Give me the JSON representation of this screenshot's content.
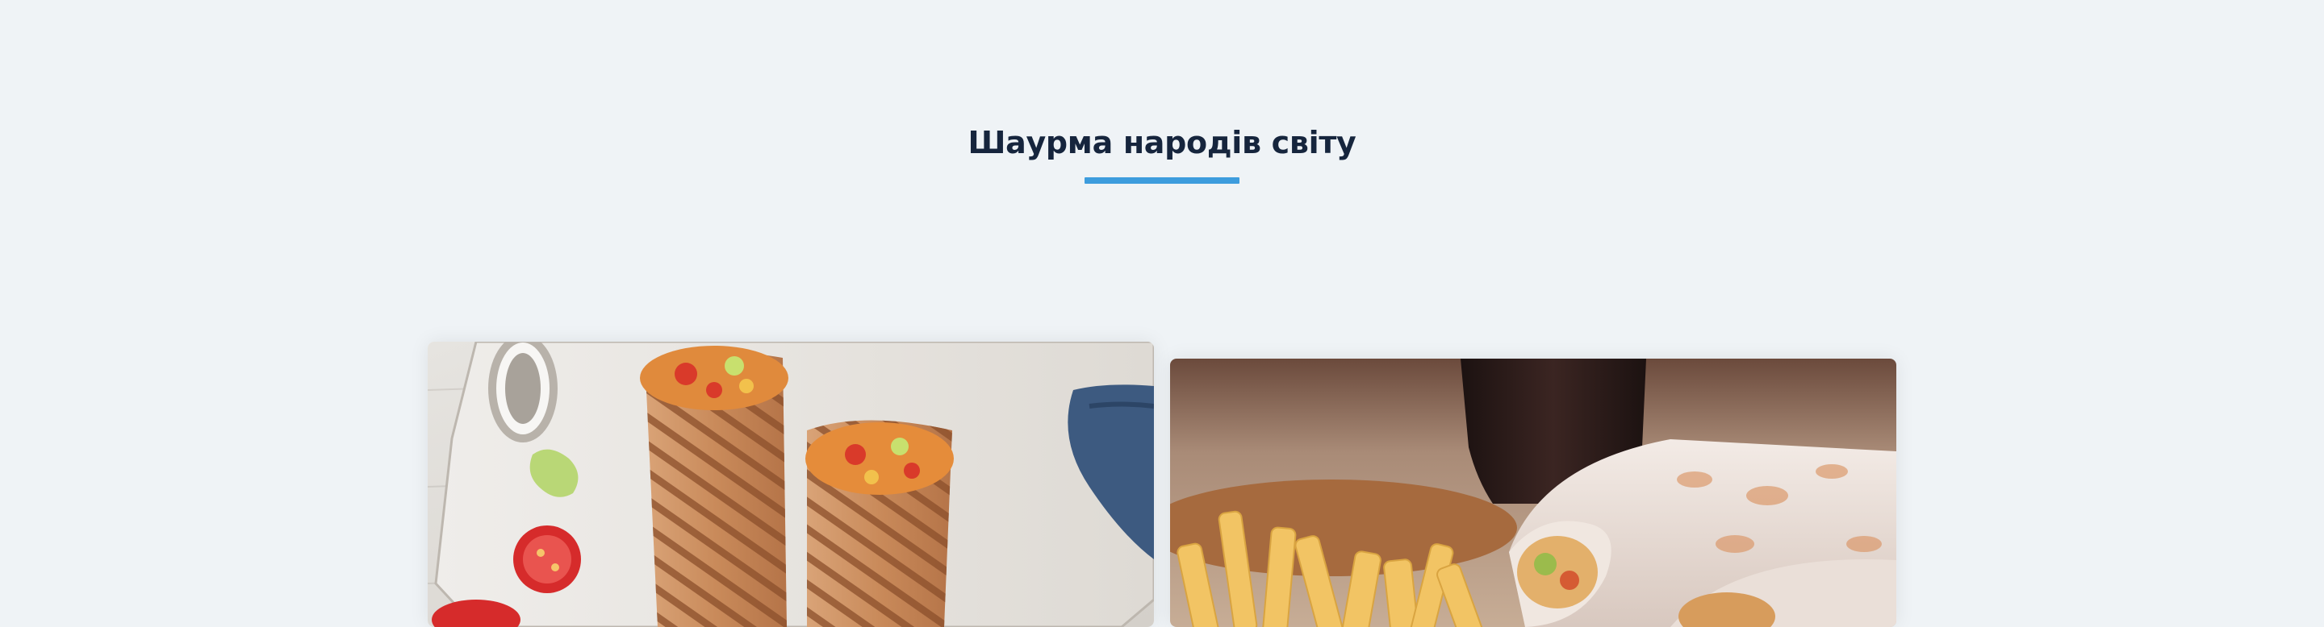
{
  "section": {
    "title": "Шаурма народів світу",
    "accent_color": "#3d9cdd",
    "title_color": "#16253d",
    "background": "#eff3f6"
  },
  "cards": [
    {
      "image": "shawarma-rolls-on-cutting-board-photo"
    },
    {
      "image": "shawarma-with-fries-and-cola-photo"
    }
  ]
}
